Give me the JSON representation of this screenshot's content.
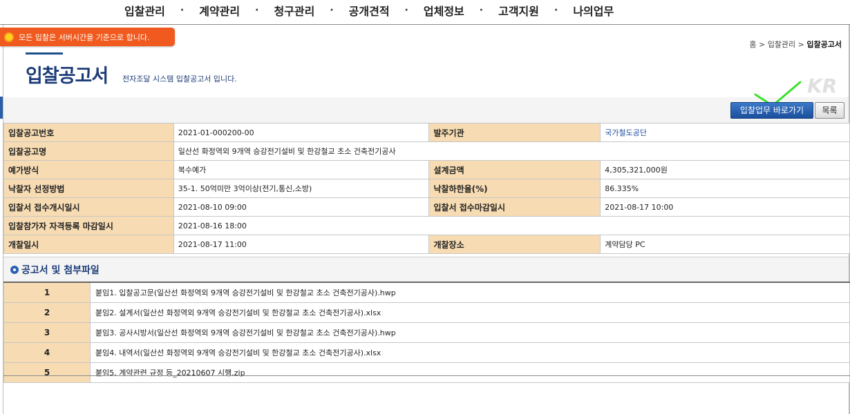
{
  "nav": [
    "입찰관리",
    "계약관리",
    "청구관리",
    "공개견적",
    "업체정보",
    "고객지원",
    "나의업무"
  ],
  "nav_sep": "·",
  "notice": "모든 입찰은 서버시간을 기준으로 합니다.",
  "breadcrumb": {
    "home": "홈",
    "sep": ">",
    "level1": "입찰관리",
    "current": "입찰공고서"
  },
  "page": {
    "title": "입찰공고서",
    "subtitle": "전자조달 시스템 입찰공고서 입니다."
  },
  "buttons": {
    "go": "입찰업무 바로가기",
    "list": "목록"
  },
  "info": {
    "bid_no_label": "입찰공고번호",
    "bid_no": "2021-01-000200-00",
    "agency_label": "발주기관",
    "agency": "국가철도공단",
    "bid_name_label": "입찰공고명",
    "bid_name": "일산선 화정역외 9개역 승강전기설비 및 한강철교 초소 건축전기공사",
    "price_method_label": "예가방식",
    "price_method": "복수예가",
    "design_amount_label": "설계금액",
    "design_amount": "4,305,321,000원",
    "selection_label": "낙찰자 선정방법",
    "selection": "35-1. 50억미만 3억이상(전기,통신,소방)",
    "lower_rate_label": "낙찰하한율(%)",
    "lower_rate": "86.335%",
    "recv_start_label": "입찰서 접수개시일시",
    "recv_start": "2021-08-10 09:00",
    "recv_end_label": "입찰서 접수마감일시",
    "recv_end": "2021-08-17 10:00",
    "reg_deadline_label": "입찰참가자 자격등록 마감일시",
    "reg_deadline": "2021-08-16 18:00",
    "open_label": "개찰일시",
    "open": "2021-08-17 11:00",
    "place_label": "개찰장소",
    "place": "계약담당 PC"
  },
  "files_section": "공고서 및 첨부파일",
  "files": [
    {
      "num": "1",
      "name": "붙임1. 입찰공고문(일산선 화정역외 9개역 승강전기설비 및 한강철교 초소 건축전기공사).hwp"
    },
    {
      "num": "2",
      "name": "붙임2. 설계서(일산선 화정역외 9개역 승강전기설비 및 한강철교 초소 건축전기공사).xlsx"
    },
    {
      "num": "3",
      "name": "붙임3. 공사시방서(일산선 화정역외 9개역 승강전기설비 및 한강철교 초소 건축전기공사).hwp"
    },
    {
      "num": "4",
      "name": "붙임4. 내역서(일산선 화정역외 9개역 승강전기설비 및 한강철교 초소 건축전기공사).xlsx"
    },
    {
      "num": "5",
      "name": "붙임5. 계약관련 규정 등_20210607 시행.zip"
    }
  ],
  "logo_text": "KR",
  "colors": {
    "accent": "#1d3c78",
    "header_cell": "#f7dcb3",
    "notice": "#f05a1e",
    "button": "#2a62b3"
  }
}
